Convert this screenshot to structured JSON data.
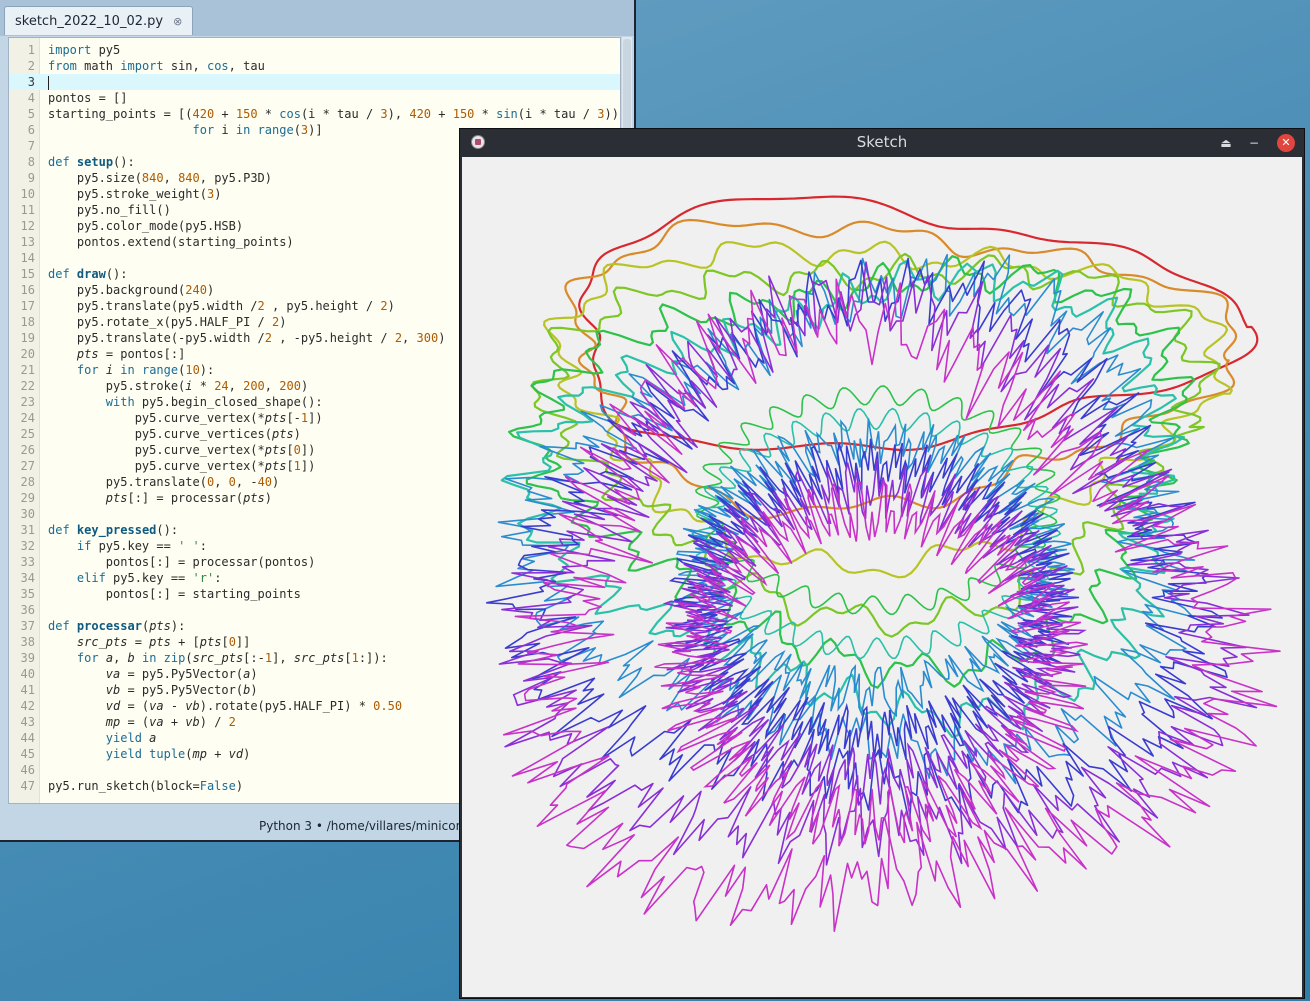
{
  "editor": {
    "tab_title": "sketch_2022_10_02.py",
    "tab_close": "⊗",
    "status": "Python 3  •  /home/villares/minicon",
    "current_line": 3,
    "lines": [
      [
        [
          "kw",
          "import"
        ],
        [
          "c",
          " py5"
        ]
      ],
      [
        [
          "kw",
          "from"
        ],
        [
          "c",
          " math "
        ],
        [
          "kw",
          "import"
        ],
        [
          "c",
          " sin, "
        ],
        [
          "bi",
          "cos"
        ],
        [
          "c",
          ", tau"
        ]
      ],
      [],
      [
        [
          "c",
          "pontos = []"
        ]
      ],
      [
        [
          "c",
          "starting_points = [("
        ],
        [
          "num",
          "420"
        ],
        [
          "c",
          " + "
        ],
        [
          "num",
          "150"
        ],
        [
          "c",
          " * "
        ],
        [
          "bi",
          "cos"
        ],
        [
          "c",
          "(i * tau / "
        ],
        [
          "num",
          "3"
        ],
        [
          "c",
          "), "
        ],
        [
          "num",
          "420"
        ],
        [
          "c",
          " + "
        ],
        [
          "num",
          "150"
        ],
        [
          "c",
          " * "
        ],
        [
          "bi",
          "sin"
        ],
        [
          "c",
          "(i * tau / "
        ],
        [
          "num",
          "3"
        ],
        [
          "c",
          "))"
        ]
      ],
      [
        [
          "c",
          "                    "
        ],
        [
          "kw",
          "for"
        ],
        [
          "c",
          " i "
        ],
        [
          "kw",
          "in"
        ],
        [
          "c",
          " "
        ],
        [
          "bi",
          "range"
        ],
        [
          "c",
          "("
        ],
        [
          "num",
          "3"
        ],
        [
          "c",
          ")]"
        ]
      ],
      [],
      [
        [
          "kw",
          "def"
        ],
        [
          "c",
          " "
        ],
        [
          "fn",
          "setup"
        ],
        [
          "c",
          "():"
        ]
      ],
      [
        [
          "c",
          "    py5.size("
        ],
        [
          "num",
          "840"
        ],
        [
          "c",
          ", "
        ],
        [
          "num",
          "840"
        ],
        [
          "c",
          ", py5.P3D)"
        ]
      ],
      [
        [
          "c",
          "    py5.stroke_weight("
        ],
        [
          "num",
          "3"
        ],
        [
          "c",
          ")"
        ]
      ],
      [
        [
          "c",
          "    py5.no_fill()"
        ]
      ],
      [
        [
          "c",
          "    py5.color_mode(py5.HSB)"
        ]
      ],
      [
        [
          "c",
          "    pontos.extend(starting_points)"
        ]
      ],
      [],
      [
        [
          "kw",
          "def"
        ],
        [
          "c",
          " "
        ],
        [
          "fn",
          "draw"
        ],
        [
          "c",
          "():"
        ]
      ],
      [
        [
          "c",
          "    py5.background("
        ],
        [
          "num",
          "240"
        ],
        [
          "c",
          ")"
        ]
      ],
      [
        [
          "c",
          "    py5.translate(py5.width /"
        ],
        [
          "num",
          "2"
        ],
        [
          "c",
          " , py5.height / "
        ],
        [
          "num",
          "2"
        ],
        [
          "c",
          ")"
        ]
      ],
      [
        [
          "c",
          "    py5.rotate_x(py5.HALF_PI / "
        ],
        [
          "num",
          "2"
        ],
        [
          "c",
          ")"
        ]
      ],
      [
        [
          "c",
          "    py5.translate(-py5.width /"
        ],
        [
          "num",
          "2"
        ],
        [
          "c",
          " , -py5.height / "
        ],
        [
          "num",
          "2"
        ],
        [
          "c",
          ", "
        ],
        [
          "num",
          "300"
        ],
        [
          "c",
          ")"
        ]
      ],
      [
        [
          "c",
          "    "
        ],
        [
          "it",
          "pts"
        ],
        [
          "c",
          " = pontos[:]"
        ]
      ],
      [
        [
          "c",
          "    "
        ],
        [
          "kw",
          "for"
        ],
        [
          "c",
          " "
        ],
        [
          "it",
          "i"
        ],
        [
          "c",
          " "
        ],
        [
          "kw",
          "in"
        ],
        [
          "c",
          " "
        ],
        [
          "bi",
          "range"
        ],
        [
          "c",
          "("
        ],
        [
          "num",
          "10"
        ],
        [
          "c",
          "):"
        ]
      ],
      [
        [
          "c",
          "        py5.stroke("
        ],
        [
          "it",
          "i"
        ],
        [
          "c",
          " * "
        ],
        [
          "num",
          "24"
        ],
        [
          "c",
          ", "
        ],
        [
          "num",
          "200"
        ],
        [
          "c",
          ", "
        ],
        [
          "num",
          "200"
        ],
        [
          "c",
          ")"
        ]
      ],
      [
        [
          "c",
          "        "
        ],
        [
          "kw",
          "with"
        ],
        [
          "c",
          " py5.begin_closed_shape():"
        ]
      ],
      [
        [
          "c",
          "            py5.curve_vertex(*"
        ],
        [
          "it",
          "pts"
        ],
        [
          "c",
          "[-"
        ],
        [
          "num",
          "1"
        ],
        [
          "c",
          "])"
        ]
      ],
      [
        [
          "c",
          "            py5.curve_vertices("
        ],
        [
          "it",
          "pts"
        ],
        [
          "c",
          ")"
        ]
      ],
      [
        [
          "c",
          "            py5.curve_vertex(*"
        ],
        [
          "it",
          "pts"
        ],
        [
          "c",
          "["
        ],
        [
          "num",
          "0"
        ],
        [
          "c",
          "])"
        ]
      ],
      [
        [
          "c",
          "            py5.curve_vertex(*"
        ],
        [
          "it",
          "pts"
        ],
        [
          "c",
          "["
        ],
        [
          "num",
          "1"
        ],
        [
          "c",
          "])"
        ]
      ],
      [
        [
          "c",
          "        py5.translate("
        ],
        [
          "num",
          "0"
        ],
        [
          "c",
          ", "
        ],
        [
          "num",
          "0"
        ],
        [
          "c",
          ", -"
        ],
        [
          "num",
          "40"
        ],
        [
          "c",
          ")"
        ]
      ],
      [
        [
          "c",
          "        "
        ],
        [
          "it",
          "pts"
        ],
        [
          "c",
          "[:] = processar("
        ],
        [
          "it",
          "pts"
        ],
        [
          "c",
          ")"
        ]
      ],
      [],
      [
        [
          "kw",
          "def"
        ],
        [
          "c",
          " "
        ],
        [
          "fn",
          "key_pressed"
        ],
        [
          "c",
          "():"
        ]
      ],
      [
        [
          "c",
          "    "
        ],
        [
          "kw",
          "if"
        ],
        [
          "c",
          " py5.key == "
        ],
        [
          "str",
          "' '"
        ],
        [
          "c",
          ":"
        ]
      ],
      [
        [
          "c",
          "        pontos[:] = processar(pontos)"
        ]
      ],
      [
        [
          "c",
          "    "
        ],
        [
          "kw",
          "elif"
        ],
        [
          "c",
          " py5.key == "
        ],
        [
          "str",
          "'r'"
        ],
        [
          "c",
          ":"
        ]
      ],
      [
        [
          "c",
          "        pontos[:] = starting_points"
        ]
      ],
      [],
      [
        [
          "kw",
          "def"
        ],
        [
          "c",
          " "
        ],
        [
          "fn",
          "processar"
        ],
        [
          "c",
          "("
        ],
        [
          "it",
          "pts"
        ],
        [
          "c",
          "):"
        ]
      ],
      [
        [
          "c",
          "    "
        ],
        [
          "it",
          "src_pts"
        ],
        [
          "c",
          " = "
        ],
        [
          "it",
          "pts"
        ],
        [
          "c",
          " + ["
        ],
        [
          "it",
          "pts"
        ],
        [
          "c",
          "["
        ],
        [
          "num",
          "0"
        ],
        [
          "c",
          "]]"
        ]
      ],
      [
        [
          "c",
          "    "
        ],
        [
          "kw",
          "for"
        ],
        [
          "c",
          " "
        ],
        [
          "it",
          "a"
        ],
        [
          "c",
          ", "
        ],
        [
          "it",
          "b"
        ],
        [
          "c",
          " "
        ],
        [
          "kw",
          "in"
        ],
        [
          "c",
          " "
        ],
        [
          "bi",
          "zip"
        ],
        [
          "c",
          "("
        ],
        [
          "it",
          "src_pts"
        ],
        [
          "c",
          "[:-"
        ],
        [
          "num",
          "1"
        ],
        [
          "c",
          "], "
        ],
        [
          "it",
          "src_pts"
        ],
        [
          "c",
          "["
        ],
        [
          "num",
          "1"
        ],
        [
          "c",
          ":]):"
        ]
      ],
      [
        [
          "c",
          "        "
        ],
        [
          "it",
          "va"
        ],
        [
          "c",
          " = py5.Py5Vector("
        ],
        [
          "it",
          "a"
        ],
        [
          "c",
          ")"
        ]
      ],
      [
        [
          "c",
          "        "
        ],
        [
          "it",
          "vb"
        ],
        [
          "c",
          " = py5.Py5Vector("
        ],
        [
          "it",
          "b"
        ],
        [
          "c",
          ")"
        ]
      ],
      [
        [
          "c",
          "        "
        ],
        [
          "it",
          "vd"
        ],
        [
          "c",
          " = ("
        ],
        [
          "it",
          "va"
        ],
        [
          "c",
          " - "
        ],
        [
          "it",
          "vb"
        ],
        [
          "c",
          ").rotate(py5.HALF_PI) * "
        ],
        [
          "num",
          "0.50"
        ]
      ],
      [
        [
          "c",
          "        "
        ],
        [
          "it",
          "mp"
        ],
        [
          "c",
          " = ("
        ],
        [
          "it",
          "va"
        ],
        [
          "c",
          " + "
        ],
        [
          "it",
          "vb"
        ],
        [
          "c",
          ") / "
        ],
        [
          "num",
          "2"
        ]
      ],
      [
        [
          "c",
          "        "
        ],
        [
          "kw",
          "yield"
        ],
        [
          "c",
          " "
        ],
        [
          "it",
          "a"
        ]
      ],
      [
        [
          "c",
          "        "
        ],
        [
          "kw",
          "yield"
        ],
        [
          "c",
          " "
        ],
        [
          "bi",
          "tuple"
        ],
        [
          "c",
          "("
        ],
        [
          "it",
          "mp"
        ],
        [
          "c",
          " + "
        ],
        [
          "it",
          "vd"
        ],
        [
          "c",
          ")"
        ]
      ],
      [],
      [
        [
          "c",
          "py5.run_sketch(block="
        ],
        [
          "kw",
          "False"
        ],
        [
          "c",
          ")"
        ]
      ]
    ]
  },
  "sketch": {
    "title": "Sketch",
    "eject_icon": "⏏",
    "minimize_icon": "−",
    "close_icon": "✕",
    "icons": [
      "app-icon",
      "eject-icon",
      "minimize-icon",
      "close-icon"
    ],
    "background": "#f0f0f0",
    "layer_colors": [
      "#d8282f",
      "#d98a2a",
      "#b8c425",
      "#7cc625",
      "#2ec24a",
      "#2bc0a8",
      "#2a8cd0",
      "#3a3cd0",
      "#8a2fd6",
      "#c832c8"
    ]
  }
}
